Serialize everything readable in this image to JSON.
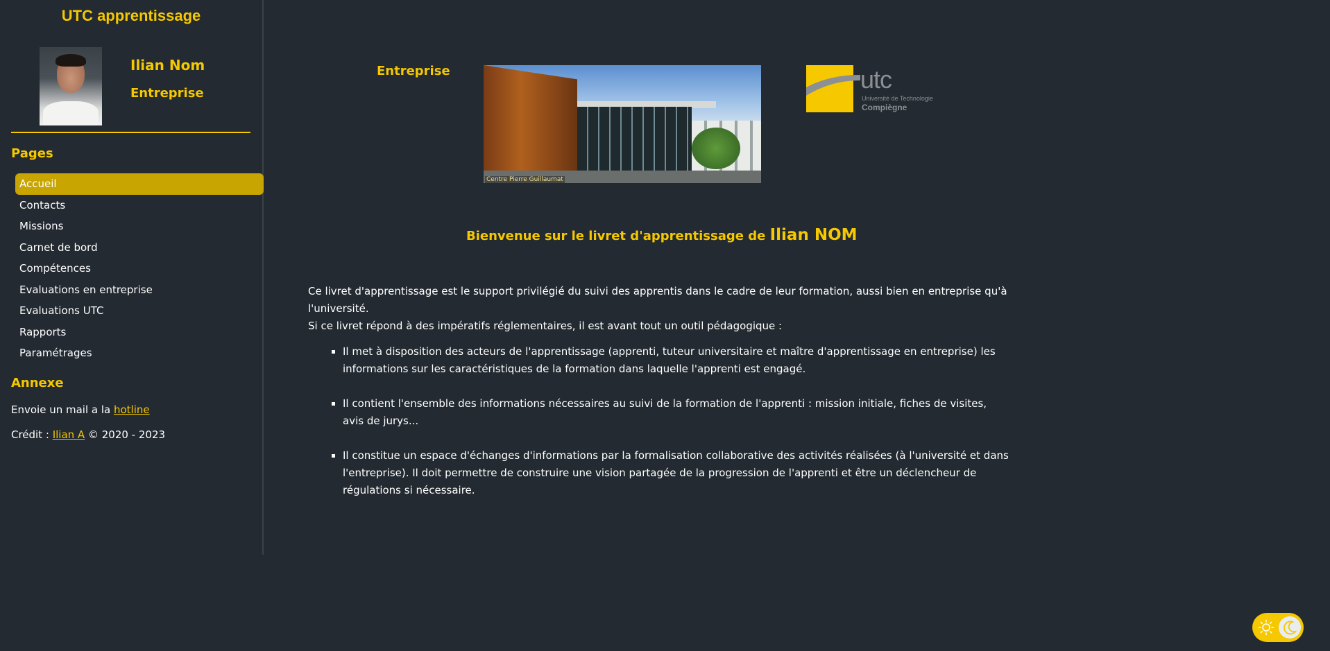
{
  "sidebar": {
    "app_title": "UTC apprentissage",
    "user": {
      "name": "Ilian Nom",
      "company": "Entreprise"
    },
    "pages_heading": "Pages",
    "items": [
      {
        "label": "Accueil",
        "active": true
      },
      {
        "label": "Contacts"
      },
      {
        "label": "Missions"
      },
      {
        "label": "Carnet de bord"
      },
      {
        "label": "Compétences"
      },
      {
        "label": "Evaluations en entreprise"
      },
      {
        "label": "Evaluations UTC"
      },
      {
        "label": "Rapports"
      },
      {
        "label": "Paramétrages"
      }
    ],
    "annex_heading": "Annexe",
    "hotline_prefix": "Envoie un mail a la ",
    "hotline_link": "hotline",
    "credit_prefix": "Crédit : ",
    "credit_link": "Ilian A",
    "credit_suffix": " © 2020 - 2023"
  },
  "main": {
    "company_label": "Entreprise",
    "photo_caption": "Centre Pierre Guillaumat",
    "logo": {
      "text": "utc",
      "sub1": "Université de Technologie",
      "sub2": "Compiègne"
    },
    "welcome_prefix": "Bienvenue sur le livret d'apprentissage de ",
    "welcome_name": "Ilian NOM",
    "intro_p1": "Ce livret d'apprentissage est le support privilégié du suivi des apprentis dans le cadre de leur formation, aussi bien en entreprise qu'à l'université.",
    "intro_p2": "Si ce livret répond à des impératifs réglementaires, il est avant tout un outil pédagogique :",
    "bullets": [
      "Il met à disposition des acteurs de l'apprentissage (apprenti, tuteur universitaire et maître d'apprentissage en entreprise) les informations sur les caractéristiques de la formation dans laquelle l'apprenti est engagé.",
      "Il contient l'ensemble des informations nécessaires au suivi de la formation de l'apprenti : mission initiale, fiches de visites, avis de jurys...",
      "Il constitue un espace d'échanges d'informations par la formalisation collaborative des activités réalisées (à l'université et dans l'entreprise). Il doit permettre de construire une vision partagée de la progression de l'apprenti et être un déclencheur de régulations si nécessaire."
    ]
  },
  "theme_toggle": {
    "sun_icon": "sun-icon",
    "moon_icon": "moon-icon"
  },
  "colors": {
    "accent": "#f5c800",
    "background": "#232a31",
    "active_nav": "#c8a500"
  }
}
